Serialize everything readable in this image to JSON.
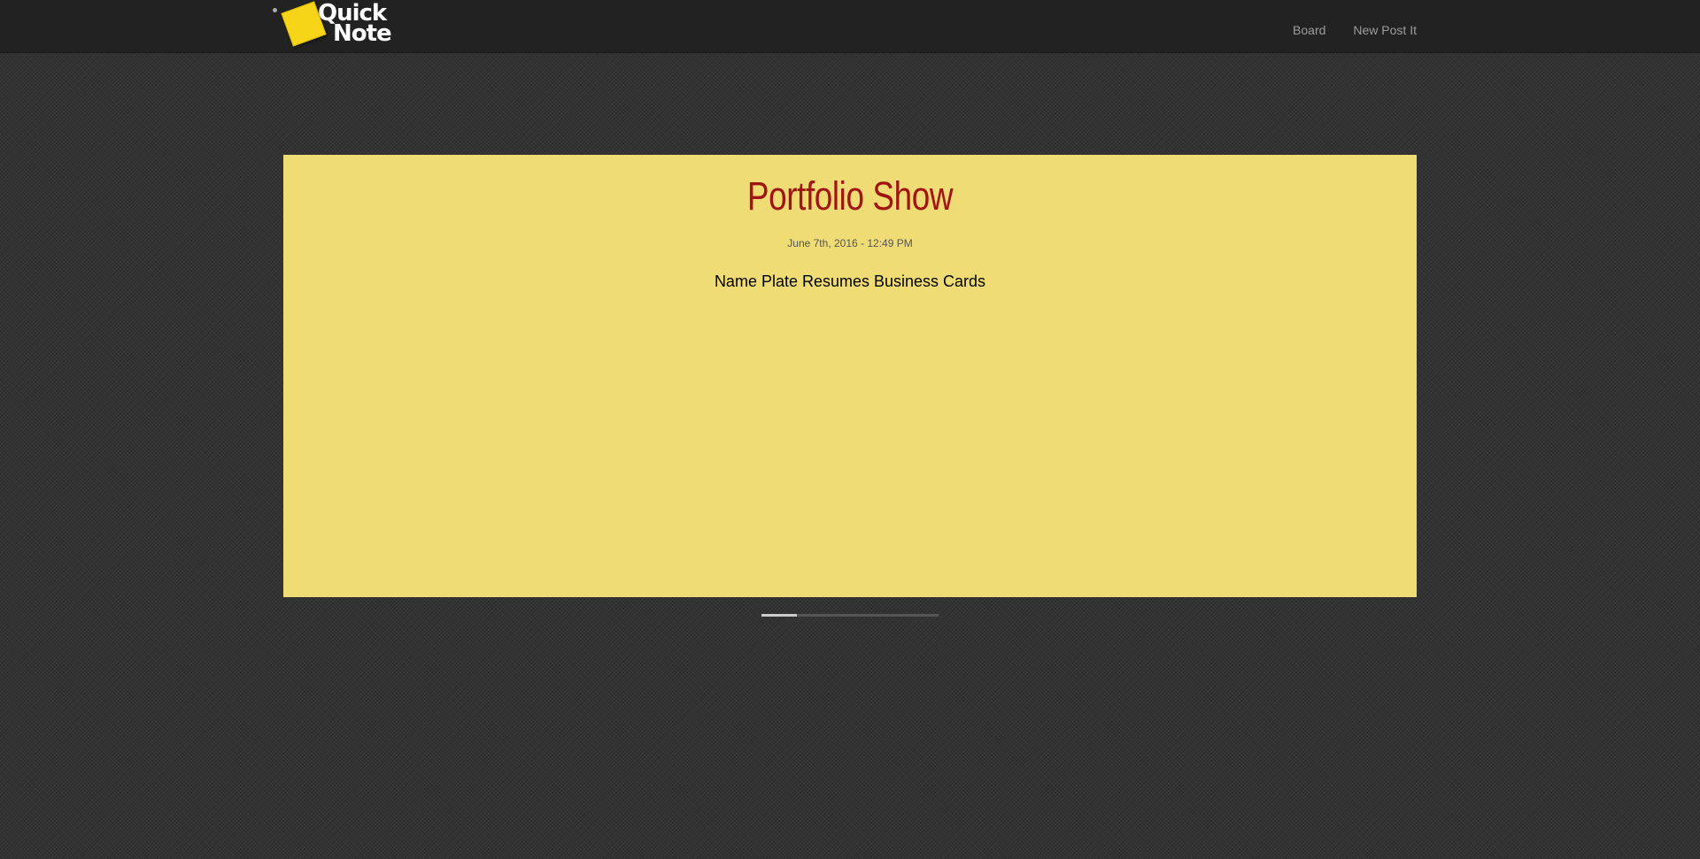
{
  "brand": {
    "line1": "Quick",
    "line2": "Note"
  },
  "nav": {
    "links": [
      "Board",
      "New Post It"
    ]
  },
  "note": {
    "title": "Portfolio Show",
    "date": "June 7th, 2016 - 12:49 PM",
    "body": "Name Plate Resumes Business Cards",
    "color": "#f0dc74",
    "title_color": "#a01414"
  },
  "slider": {
    "progress_fraction": 0.2
  }
}
